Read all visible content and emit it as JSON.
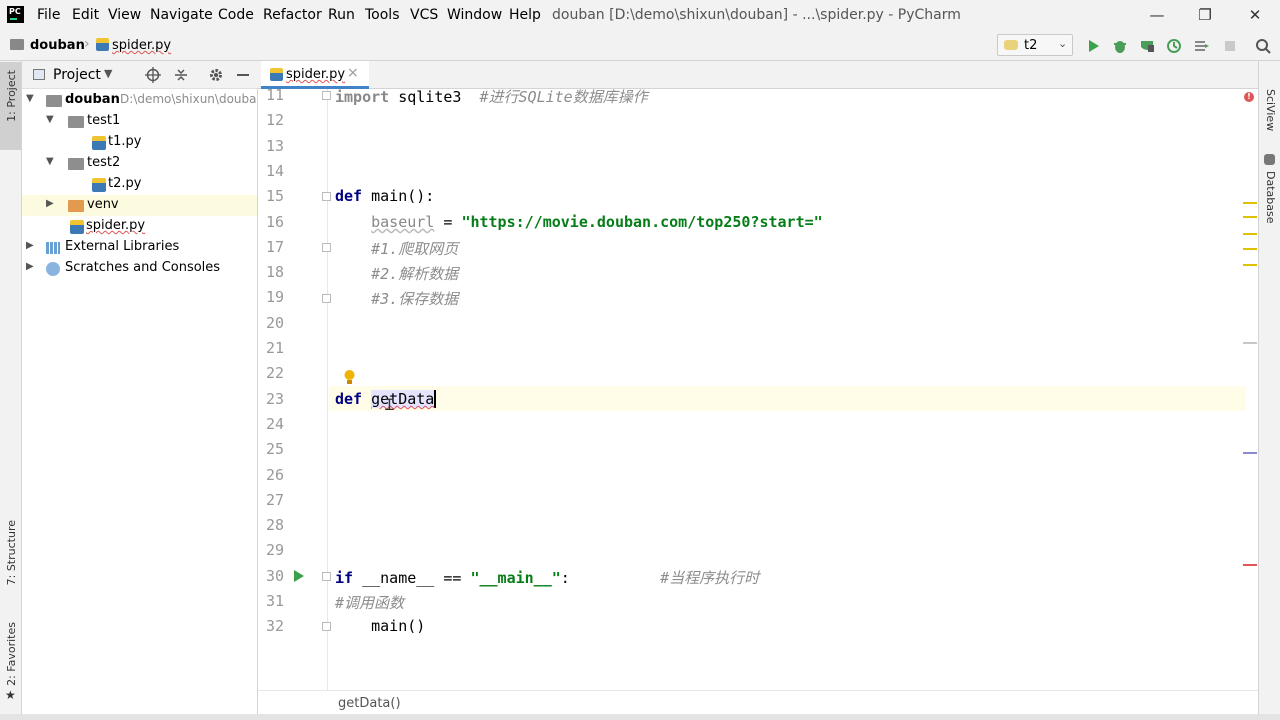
{
  "app": {
    "logo_text": "PC",
    "window_title": "douban [D:\\demo\\shixun\\douban] - ...\\spider.py - PyCharm"
  },
  "menu": [
    "File",
    "Edit",
    "View",
    "Navigate",
    "Code",
    "Refactor",
    "Run",
    "Tools",
    "VCS",
    "Window",
    "Help"
  ],
  "window_controls": {
    "minimize": "—",
    "restore": "❐",
    "close": "✕"
  },
  "nav": {
    "root": "douban",
    "separator": "›",
    "file": "spider.py"
  },
  "run_config": {
    "selected": "t2",
    "chevron": "⌄"
  },
  "toolbar_icons": [
    "run-icon",
    "debug-icon",
    "coverage-icon",
    "profile-icon",
    "concurrency-icon",
    "stop-icon",
    "search-icon"
  ],
  "left_tools": {
    "project": "1: Project",
    "structure": "7: Structure",
    "favorites": "2: Favorites"
  },
  "project_panel": {
    "title": "Project",
    "tree": [
      {
        "label": "douban",
        "path": "D:\\demo\\shixun\\douban",
        "depth": 0,
        "type": "folder",
        "expanded": true
      },
      {
        "label": "test1",
        "depth": 1,
        "type": "folder",
        "expanded": true
      },
      {
        "label": "t1.py",
        "depth": 2,
        "type": "py"
      },
      {
        "label": "test2",
        "depth": 1,
        "type": "folder",
        "expanded": true
      },
      {
        "label": "t2.py",
        "depth": 2,
        "type": "py"
      },
      {
        "label": "venv",
        "depth": 1,
        "type": "venv",
        "expanded": false
      },
      {
        "label": "spider.py",
        "depth": 1,
        "type": "py"
      },
      {
        "label": "External Libraries",
        "depth": 0,
        "type": "lib",
        "expanded": false
      },
      {
        "label": "Scratches and Consoles",
        "depth": 0,
        "type": "scratch",
        "expanded": false
      }
    ]
  },
  "editor": {
    "tab_label": "spider.py",
    "tab_close": "×",
    "lines": [
      {
        "n": "11",
        "code": [
          [
            "kw2",
            "import"
          ],
          [
            "plain",
            " sqlite3  "
          ],
          [
            "cm",
            "#进行SQLite数据库操作"
          ]
        ]
      },
      {
        "n": "12",
        "code": []
      },
      {
        "n": "13",
        "code": []
      },
      {
        "n": "14",
        "code": []
      },
      {
        "n": "15",
        "code": [
          [
            "kw",
            "def"
          ],
          [
            "plain",
            " main():"
          ]
        ]
      },
      {
        "n": "16",
        "code": [
          [
            "plain",
            "    "
          ],
          [
            "var",
            "baseurl"
          ],
          [
            "plain",
            " = "
          ],
          [
            "str",
            "\"https://movie.douban.com/top250?start=\""
          ]
        ]
      },
      {
        "n": "17",
        "code": [
          [
            "plain",
            "    "
          ],
          [
            "cm",
            "#1.爬取网页"
          ]
        ]
      },
      {
        "n": "18",
        "code": [
          [
            "plain",
            "    "
          ],
          [
            "cm",
            "#2.解析数据"
          ]
        ]
      },
      {
        "n": "19",
        "code": [
          [
            "plain",
            "    "
          ],
          [
            "cm",
            "#3.保存数据"
          ]
        ]
      },
      {
        "n": "20",
        "code": []
      },
      {
        "n": "21",
        "code": []
      },
      {
        "n": "22",
        "code": []
      },
      {
        "n": "23",
        "code": [
          [
            "kw",
            "def"
          ],
          [
            "plain",
            " "
          ],
          [
            "sel",
            "getData"
          ]
        ]
      },
      {
        "n": "24",
        "code": []
      },
      {
        "n": "25",
        "code": []
      },
      {
        "n": "26",
        "code": []
      },
      {
        "n": "27",
        "code": []
      },
      {
        "n": "28",
        "code": []
      },
      {
        "n": "29",
        "code": []
      },
      {
        "n": "30",
        "code": [
          [
            "kw",
            "if"
          ],
          [
            "plain",
            " __name__ == "
          ],
          [
            "str",
            "\"__main__\""
          ],
          [
            "plain",
            ":          "
          ],
          [
            "cm",
            "#当程序执行时"
          ]
        ]
      },
      {
        "n": "31",
        "code": [
          [
            "cm",
            "#调用函数"
          ]
        ]
      },
      {
        "n": "32",
        "code": [
          [
            "plain",
            "    main()"
          ]
        ]
      }
    ],
    "breadcrumb": "getData()"
  },
  "right_tools": {
    "sciview": "SciView",
    "database": "Database"
  },
  "colors": {
    "accent": "#4083c9",
    "keyword": "#000080",
    "string": "#067d17",
    "comment": "#8c8c8c",
    "warning": "#e0c000",
    "error": "#e05555"
  }
}
